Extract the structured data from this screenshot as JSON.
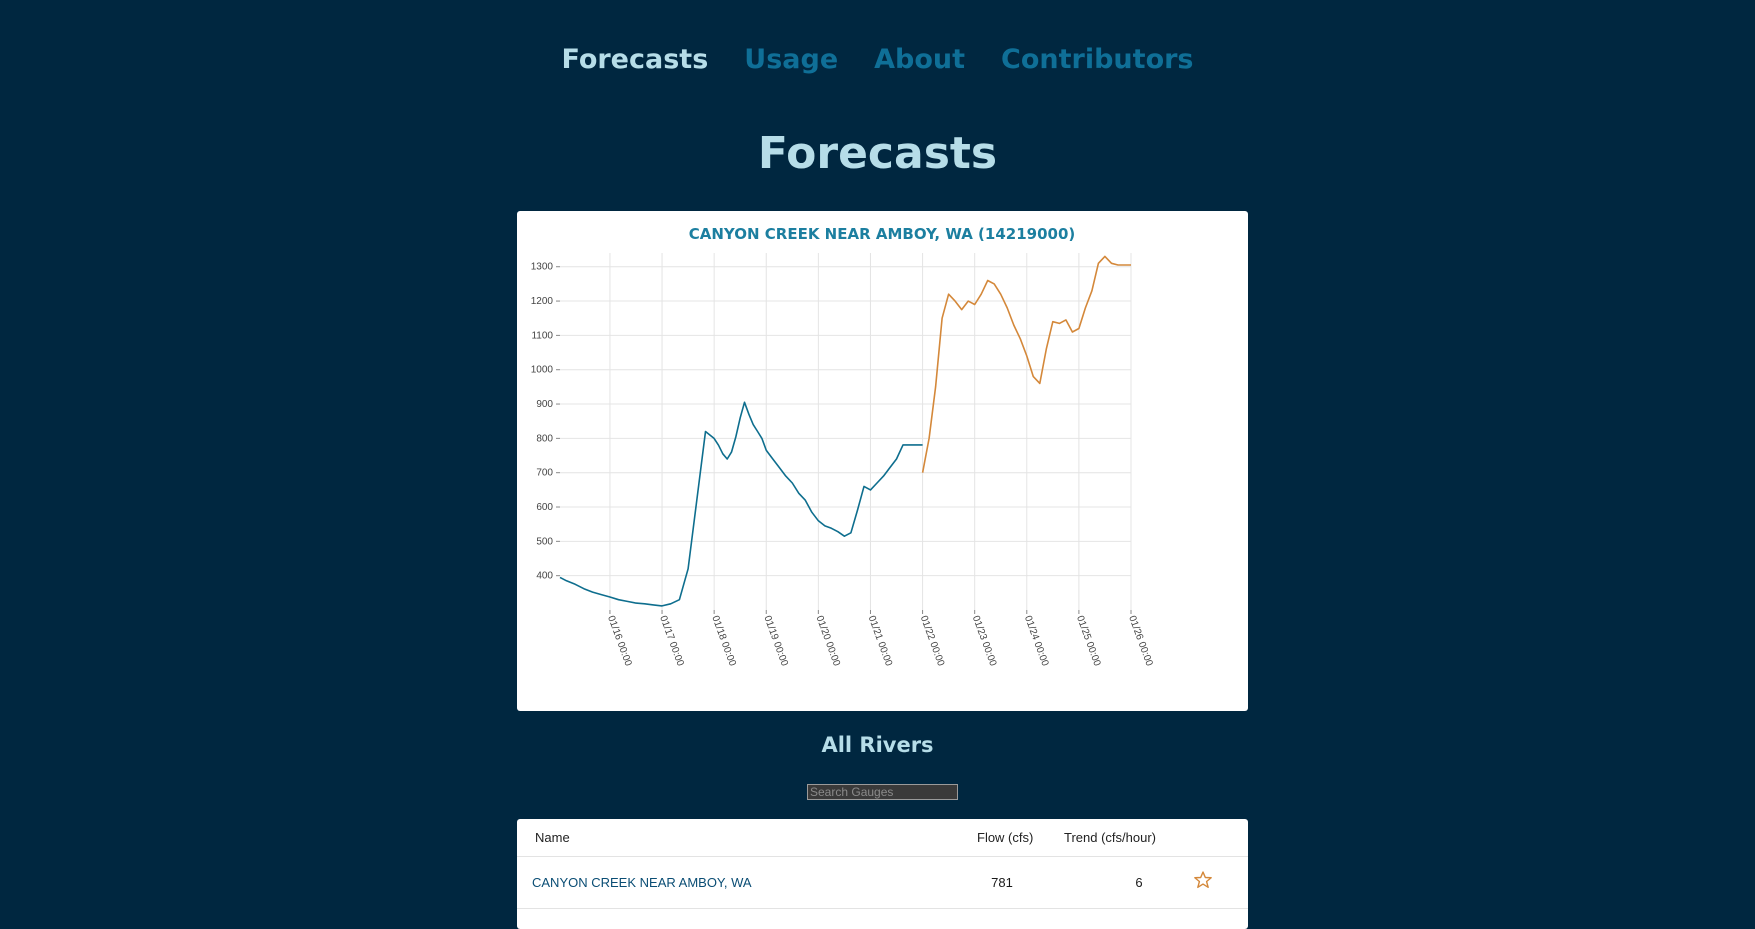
{
  "nav": {
    "items": [
      {
        "label": "Forecasts",
        "active": true
      },
      {
        "label": "Usage",
        "active": false
      },
      {
        "label": "About",
        "active": false
      },
      {
        "label": "Contributors",
        "active": false
      }
    ]
  },
  "page": {
    "title": "Forecasts"
  },
  "colors": {
    "background": "#002740",
    "active_nav": "#b6dde8",
    "nav_link": "#0f6f97",
    "chart_title": "#1c7fa0",
    "observed_line": "#0e6e8e",
    "forecast_line": "#d4883a",
    "star": "#d4883a"
  },
  "chart_data": {
    "type": "line",
    "title": "CANYON CREEK NEAR AMBOY, WA (14219000)",
    "xlabel": "",
    "ylabel": "",
    "x_ticks": [
      "01/16 00:00",
      "01/17 00:00",
      "01/18 00:00",
      "01/19 00:00",
      "01/20 00:00",
      "01/21 00:00",
      "01/22 00:00",
      "01/23 00:00",
      "01/24 00:00",
      "01/25 00:00",
      "01/26 00:00"
    ],
    "y_ticks": [
      400,
      500,
      600,
      700,
      800,
      900,
      1000,
      1100,
      1200,
      1300
    ],
    "x_range": [
      "01/15 01:00",
      "01/26 00:00"
    ],
    "ylim": [
      300,
      1340
    ],
    "grid": true,
    "series": [
      {
        "color": "#0e6e8e",
        "x": [
          "01/15 01:00",
          "01/15 04:00",
          "01/15 08:00",
          "01/15 12:00",
          "01/15 16:00",
          "01/15 20:00",
          "01/16 00:00",
          "01/16 04:00",
          "01/16 08:00",
          "01/16 12:00",
          "01/16 16:00",
          "01/16 20:00",
          "01/17 00:00",
          "01/17 04:00",
          "01/17 08:00",
          "01/17 12:00",
          "01/17 16:00",
          "01/17 20:00",
          "01/18 00:00",
          "01/18 02:00",
          "01/18 04:00",
          "01/18 06:00",
          "01/18 08:00",
          "01/18 10:00",
          "01/18 12:00",
          "01/18 14:00",
          "01/18 16:00",
          "01/18 18:00",
          "01/18 20:00",
          "01/18 22:00",
          "01/19 00:00",
          "01/19 03:00",
          "01/19 06:00",
          "01/19 09:00",
          "01/19 12:00",
          "01/19 15:00",
          "01/19 18:00",
          "01/19 21:00",
          "01/20 00:00",
          "01/20 03:00",
          "01/20 06:00",
          "01/20 09:00",
          "01/20 12:00",
          "01/20 15:00",
          "01/20 18:00",
          "01/20 21:00",
          "01/21 00:00",
          "01/21 03:00",
          "01/21 06:00",
          "01/21 09:00",
          "01/21 12:00",
          "01/21 15:00",
          "01/21 18:00",
          "01/21 21:00",
          "01/22 00:00"
        ],
        "y": [
          395,
          385,
          375,
          362,
          352,
          345,
          338,
          330,
          325,
          320,
          318,
          315,
          312,
          318,
          330,
          420,
          620,
          820,
          800,
          780,
          755,
          740,
          760,
          805,
          860,
          905,
          870,
          840,
          820,
          800,
          765,
          740,
          715,
          690,
          670,
          640,
          620,
          585,
          560,
          545,
          538,
          528,
          515,
          525,
          590,
          660,
          650,
          670,
          690,
          715,
          740,
          781,
          781,
          781,
          781
        ]
      },
      {
        "color": "#d4883a",
        "x": [
          "01/22 00:00",
          "01/22 03:00",
          "01/22 06:00",
          "01/22 09:00",
          "01/22 12:00",
          "01/22 15:00",
          "01/22 18:00",
          "01/22 21:00",
          "01/23 00:00",
          "01/23 03:00",
          "01/23 06:00",
          "01/23 09:00",
          "01/23 12:00",
          "01/23 15:00",
          "01/23 18:00",
          "01/23 21:00",
          "01/24 00:00",
          "01/24 03:00",
          "01/24 06:00",
          "01/24 09:00",
          "01/24 12:00",
          "01/24 15:00",
          "01/24 18:00",
          "01/24 21:00",
          "01/25 00:00",
          "01/25 03:00",
          "01/25 06:00",
          "01/25 09:00",
          "01/25 12:00",
          "01/25 15:00",
          "01/25 18:00",
          "01/25 21:00",
          "01/26 00:00"
        ],
        "y": [
          700,
          800,
          950,
          1150,
          1220,
          1200,
          1175,
          1200,
          1190,
          1220,
          1260,
          1250,
          1220,
          1180,
          1130,
          1090,
          1040,
          980,
          960,
          1060,
          1140,
          1135,
          1145,
          1110,
          1120,
          1180,
          1230,
          1310,
          1330,
          1310,
          1305,
          1305,
          1305
        ]
      }
    ]
  },
  "rivers": {
    "title": "All Rivers",
    "search_placeholder": "Search Gauges",
    "columns": {
      "name": "Name",
      "flow": "Flow (cfs)",
      "trend": "Trend (cfs/hour)"
    },
    "rows": [
      {
        "name": "CANYON CREEK NEAR AMBOY, WA",
        "flow": "781",
        "trend": "6",
        "favorite_icon": "star-outline-icon"
      }
    ]
  }
}
